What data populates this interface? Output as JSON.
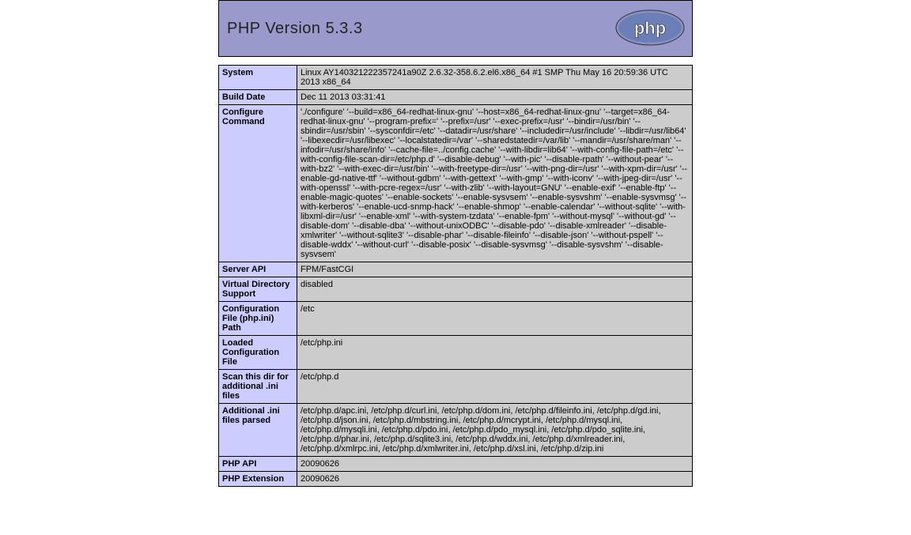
{
  "header": {
    "title": "PHP Version 5.3.3"
  },
  "rows": [
    {
      "label": "System",
      "value": "Linux AY140321222357241a90Z 2.6.32-358.6.2.el6.x86_64 #1 SMP Thu May 16 20:59:36 UTC 2013 x86_64"
    },
    {
      "label": "Build Date",
      "value": "Dec 11 2013 03:31:41"
    },
    {
      "label": "Configure Command",
      "value": " './configure'  '--build=x86_64-redhat-linux-gnu' '--host=x86_64-redhat-linux-gnu' '--target=x86_64-redhat-linux-gnu' '--program-prefix=' '--prefix=/usr' '--exec-prefix=/usr' '--bindir=/usr/bin' '--sbindir=/usr/sbin' '--sysconfdir=/etc' '--datadir=/usr/share' '--includedir=/usr/include' '--libdir=/usr/lib64' '--libexecdir=/usr/libexec' '--localstatedir=/var' '--sharedstatedir=/var/lib' '--mandir=/usr/share/man' '--infodir=/usr/share/info' '--cache-file=../config.cache' '--with-libdir=lib64' '--with-config-file-path=/etc' '--with-config-file-scan-dir=/etc/php.d' '--disable-debug' '--with-pic' '--disable-rpath' '--without-pear' '--with-bz2' '--with-exec-dir=/usr/bin' '--with-freetype-dir=/usr' '--with-png-dir=/usr' '--with-xpm-dir=/usr' '--enable-gd-native-ttf' '--without-gdbm' '--with-gettext' '--with-gmp' '--with-iconv' '--with-jpeg-dir=/usr' '--with-openssl' '--with-pcre-regex=/usr' '--with-zlib' '--with-layout=GNU' '--enable-exif' '--enable-ftp' '--enable-magic-quotes' '--enable-sockets' '--enable-sysvsem' '--enable-sysvshm' '--enable-sysvmsg' '--with-kerberos' '--enable-ucd-snmp-hack' '--enable-shmop' '--enable-calendar' '--without-sqlite' '--with-libxml-dir=/usr' '--enable-xml' '--with-system-tzdata' '--enable-fpm' '--without-mysql' '--without-gd' '--disable-dom' '--disable-dba' '--without-unixODBC' '--disable-pdo' '--disable-xmlreader' '--disable-xmlwriter' '--without-sqlite3' '--disable-phar' '--disable-fileinfo' '--disable-json' '--without-pspell' '--disable-wddx' '--without-curl' '--disable-posix' '--disable-sysvmsg' '--disable-sysvshm' '--disable-sysvsem'"
    },
    {
      "label": "Server API",
      "value": "FPM/FastCGI"
    },
    {
      "label": "Virtual Directory Support",
      "value": "disabled"
    },
    {
      "label": "Configuration File (php.ini) Path",
      "value": "/etc"
    },
    {
      "label": "Loaded Configuration File",
      "value": "/etc/php.ini"
    },
    {
      "label": "Scan this dir for additional .ini files",
      "value": "/etc/php.d"
    },
    {
      "label": "Additional .ini files parsed",
      "value": "/etc/php.d/apc.ini, /etc/php.d/curl.ini, /etc/php.d/dom.ini, /etc/php.d/fileinfo.ini, /etc/php.d/gd.ini, /etc/php.d/json.ini, /etc/php.d/mbstring.ini, /etc/php.d/mcrypt.ini, /etc/php.d/mysql.ini, /etc/php.d/mysqli.ini, /etc/php.d/pdo.ini, /etc/php.d/pdo_mysql.ini, /etc/php.d/pdo_sqlite.ini, /etc/php.d/phar.ini, /etc/php.d/sqlite3.ini, /etc/php.d/wddx.ini, /etc/php.d/xmlreader.ini, /etc/php.d/xmlrpc.ini, /etc/php.d/xmlwriter.ini, /etc/php.d/xsl.ini, /etc/php.d/zip.ini"
    },
    {
      "label": "PHP API",
      "value": "20090626"
    },
    {
      "label": "PHP Extension",
      "value": "20090626"
    }
  ]
}
